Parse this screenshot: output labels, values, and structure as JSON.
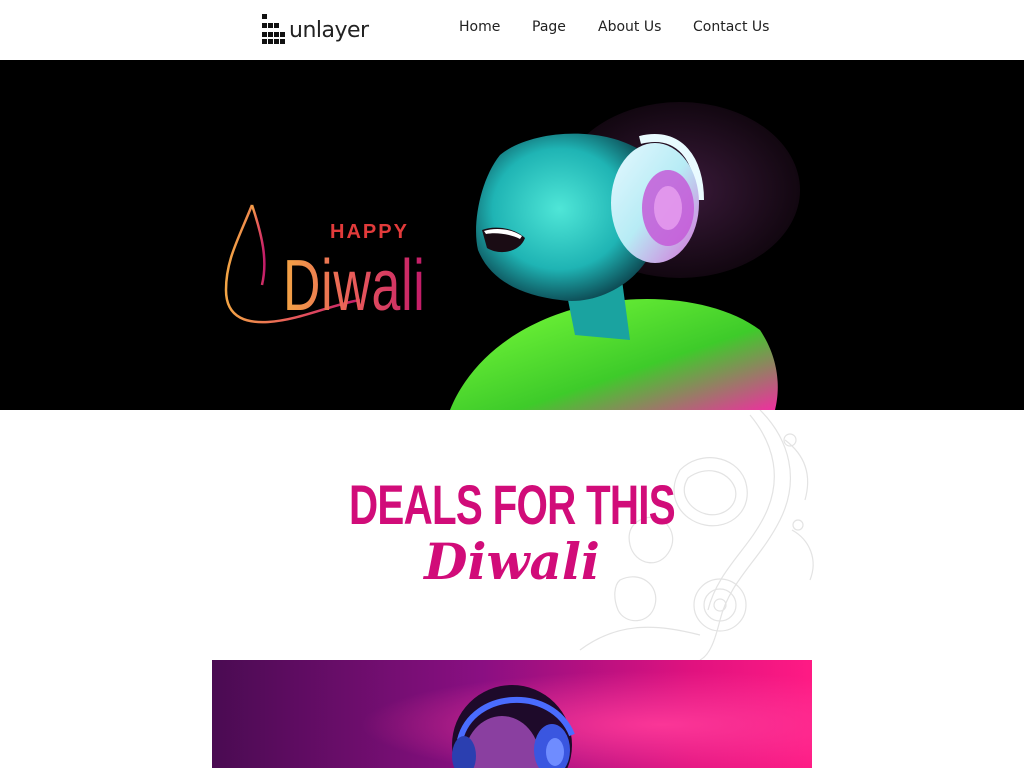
{
  "brand": {
    "name": "unlayer"
  },
  "nav": {
    "items": [
      {
        "label": "Home"
      },
      {
        "label": "Page"
      },
      {
        "label": "About Us"
      },
      {
        "label": "Contact Us"
      }
    ]
  },
  "hero": {
    "logo_small": "HAPPY",
    "logo_big": "Diwali"
  },
  "deals": {
    "title": "DEALS FOR THIS",
    "script": "Diwali"
  },
  "colors": {
    "accent": "#d10c79",
    "hero_bg": "#000000"
  }
}
